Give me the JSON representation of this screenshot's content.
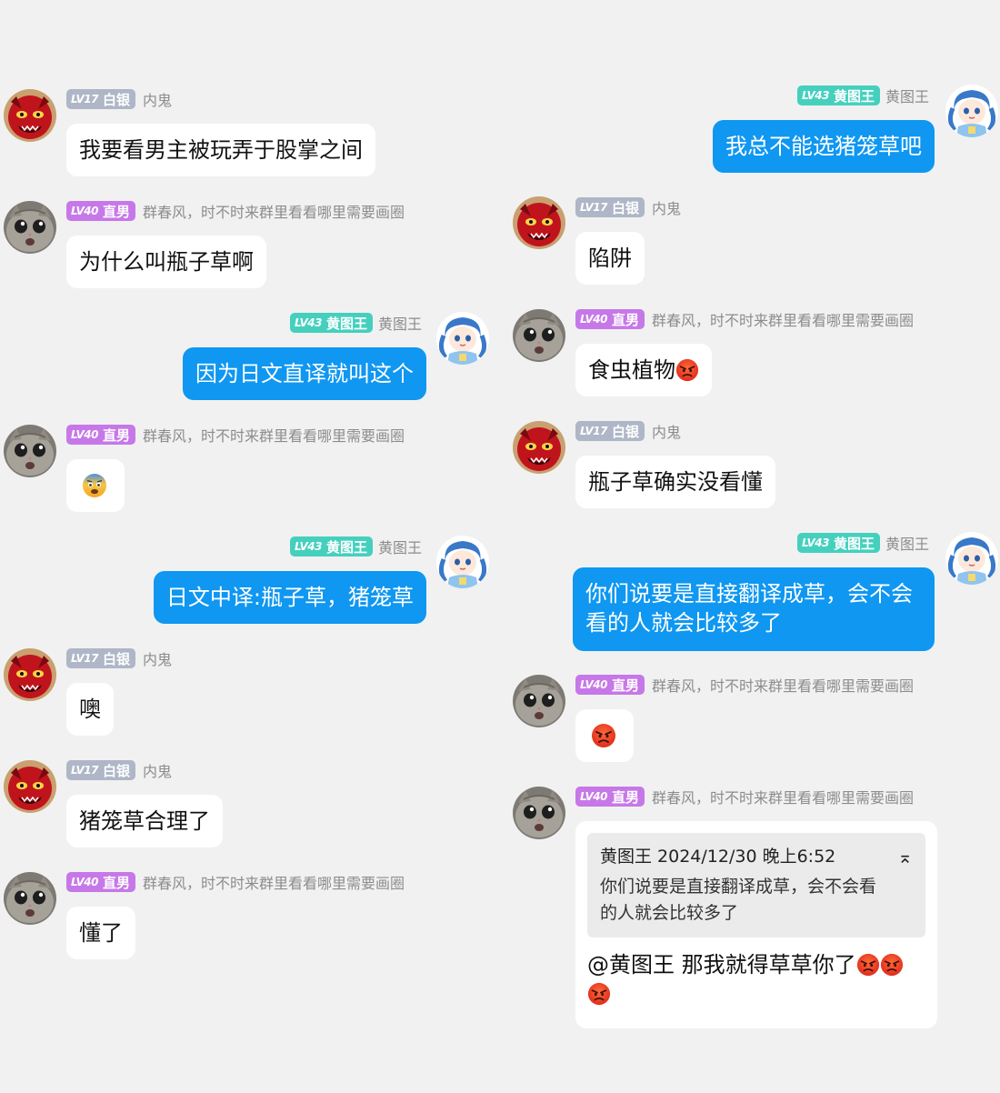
{
  "users": {
    "neigui": {
      "level": "LV17",
      "title": "白银",
      "name": "内鬼"
    },
    "zhinan": {
      "level": "LV40",
      "title": "直男",
      "name": "群春风，时不时来群里看看哪里需要画圈"
    },
    "huangtu": {
      "level": "LV43",
      "title": "黄图王",
      "name": "黄图王"
    }
  },
  "left": [
    {
      "text": "我要看男主被玩弄于股掌之间"
    },
    {
      "text": "为什么叫瓶子草啊"
    },
    {
      "text": "因为日文直译就叫这个"
    },
    {
      "emoji": "fearful-face"
    },
    {
      "text": "日文中译:瓶子草，猪笼草"
    },
    {
      "text": "噢"
    },
    {
      "text": "猪笼草合理了"
    },
    {
      "text": "懂了"
    }
  ],
  "right": [
    {
      "text": "我总不能选猪笼草吧"
    },
    {
      "text": "陷阱"
    },
    {
      "text": "食虫植物"
    },
    {
      "text": "瓶子草确实没看懂"
    },
    {
      "line1": "你们说要是直接翻译成草，会不会",
      "line2": "看的人就会比较多了"
    },
    {
      "emoji": "angry-face"
    },
    {
      "quote": {
        "author_time": "黄图王 2024/12/30 晚上6:52",
        "line1": "你们说要是直接翻译成草，会不会看",
        "line2": "的人就会比较多了"
      },
      "text": "@黄图王 那我就得草草你了"
    }
  ],
  "colors": {
    "background": "#f1f1f1",
    "blue_bubble": "#0f97f1",
    "badge_silver": "#aeb6c7",
    "badge_purple": "#c678e8",
    "badge_teal": "#45d0be"
  },
  "icons": [
    "red-demon-avatar-icon",
    "cat-avatar-icon",
    "anime-avatar-icon",
    "fearful-face-icon",
    "angry-face-icon"
  ]
}
